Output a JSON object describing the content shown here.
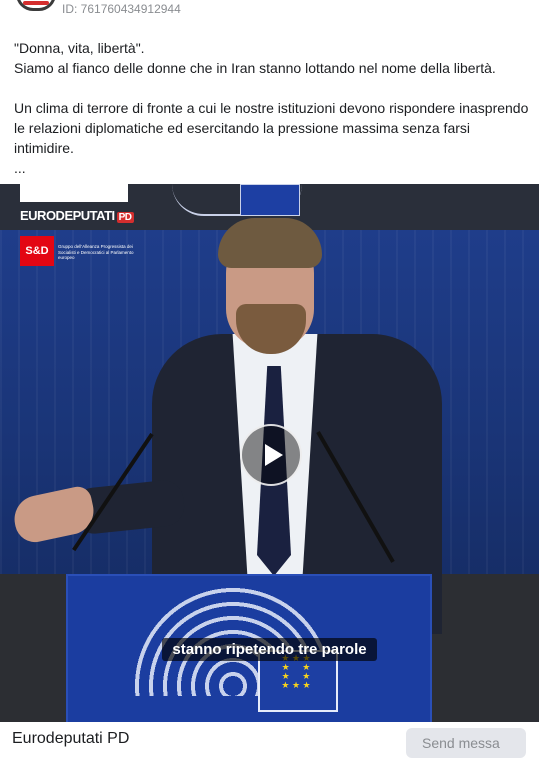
{
  "post": {
    "id_label": "ID: 761760434912944",
    "caption": {
      "line1": "\"Donna, vita, libertà\".",
      "line2": "Siamo al fianco delle donne che in Iran stanno lottando nel nome della libertà.",
      "para2": "Un clima di terrore di fronte a cui le nostre istituzioni devono rispondere inasprendo le relazioni diplomatiche ed esercitando la pressione massima senza farsi intimidire.",
      "more": "..."
    }
  },
  "video": {
    "brand": "EURODEPUTATI",
    "brand_pd": "PD",
    "group_logo": "S&D",
    "group_text": "Gruppo dell'Alleanza Progressista dei Socialisti e Democratici al Parlamento europeo",
    "subtitle": "stanno ripetendo tre parole",
    "play_icon": "play-icon"
  },
  "footer": {
    "page_name": "Eurodeputati PD",
    "send_label": "Send messa"
  },
  "colors": {
    "accent_red": "#d42e2e",
    "eu_blue": "#1d3fa3",
    "button_bg": "#e4e6eb"
  }
}
